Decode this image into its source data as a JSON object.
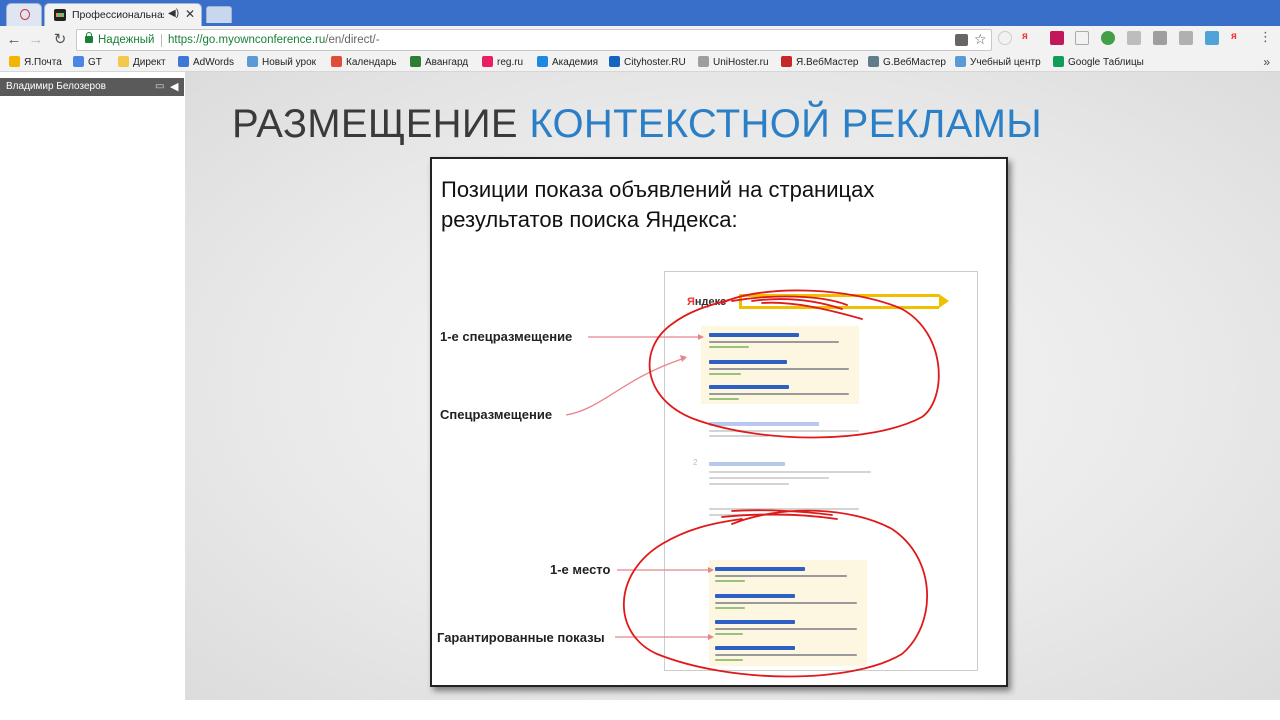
{
  "browser": {
    "tabs": [
      {
        "label": "Профессиональная Р",
        "active": true
      }
    ],
    "secure_label": "Надежный",
    "url_host": "https://go.myownconference.ru",
    "url_path": "/en/direct/-",
    "bookmarks": [
      {
        "label": "Я.Почта",
        "color": "#f2b600"
      },
      {
        "label": "GT",
        "color": "#4a86e8"
      },
      {
        "label": "Директ",
        "color": "#f2c94c"
      },
      {
        "label": "AdWords",
        "color": "#3c78d8"
      },
      {
        "label": "Новый урок",
        "color": "#5b9bd5"
      },
      {
        "label": "Календарь",
        "color": "#e04b3a"
      },
      {
        "label": "Авангард",
        "color": "#2e7d32"
      },
      {
        "label": "reg.ru",
        "color": "#e91e63"
      },
      {
        "label": "Академия",
        "color": "#1e88e5"
      },
      {
        "label": "Cityhoster.RU",
        "color": "#1565c0"
      },
      {
        "label": "UniHoster.ru",
        "color": "#9e9e9e"
      },
      {
        "label": "Я.ВебМастер",
        "color": "#c62828"
      },
      {
        "label": "G.ВебМастер",
        "color": "#607d8b"
      },
      {
        "label": "Учебный центр",
        "color": "#5b9bd5"
      },
      {
        "label": "Google Таблицы",
        "color": "#0f9d58"
      }
    ],
    "bookmarks_more": "»"
  },
  "webinar": {
    "presenter_name": "Владимир Белозеров"
  },
  "slide": {
    "title_part1": "РАЗМЕЩЕНИЕ",
    "title_part2": "КОНТЕКСТНОЙ РЕКЛАМЫ",
    "heading": "Позиции показа объявлений на страницах результатов поиска Яндекса:",
    "serp_logo": "Яндекс",
    "serp_page_num": "2",
    "labels": {
      "special_first": "1-е спецразмещение",
      "special": "Спецразмещение",
      "first_place": "1-е место",
      "guaranteed": "Гарантированные показы"
    }
  },
  "colors": {
    "title_blue": "#2a7fc7",
    "annotation_red": "#e01a1a",
    "pointer_pink": "#e8858a",
    "ad_highlight": "#fdf6e0",
    "yandex_yellow": "#f0c000"
  }
}
